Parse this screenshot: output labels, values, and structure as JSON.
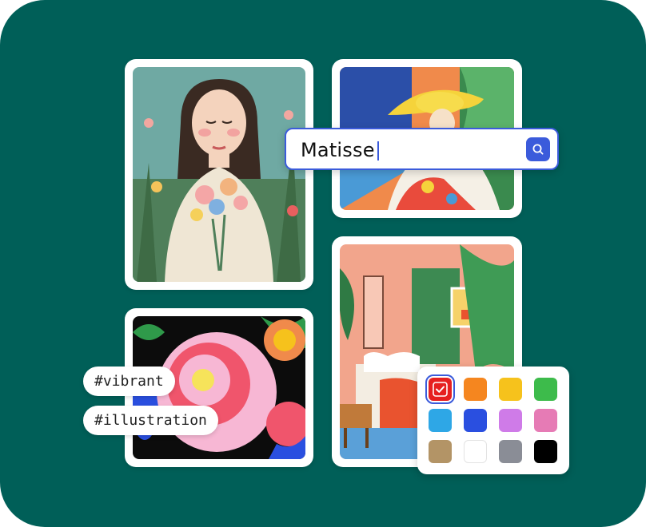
{
  "search": {
    "query": "Matisse"
  },
  "tags": [
    "#vibrant",
    "#illustration"
  ],
  "palette": {
    "selected_index": 0,
    "swatches": [
      "#e62020",
      "#f5861f",
      "#f6c21c",
      "#3dbb4b",
      "#2ea7e6",
      "#2a4fe0",
      "#cf7be8",
      "#e67bb5",
      "#b39466",
      "#ffffff",
      "#8a8d96",
      "#000000"
    ]
  },
  "colors": {
    "background": "#005f58",
    "accent": "#3b5bdb"
  },
  "images": [
    {
      "name": "girl-with-flowers-painting"
    },
    {
      "name": "woman-in-yellow-hat-painting"
    },
    {
      "name": "bedroom-interior-painting"
    },
    {
      "name": "pink-flower-painting"
    }
  ]
}
